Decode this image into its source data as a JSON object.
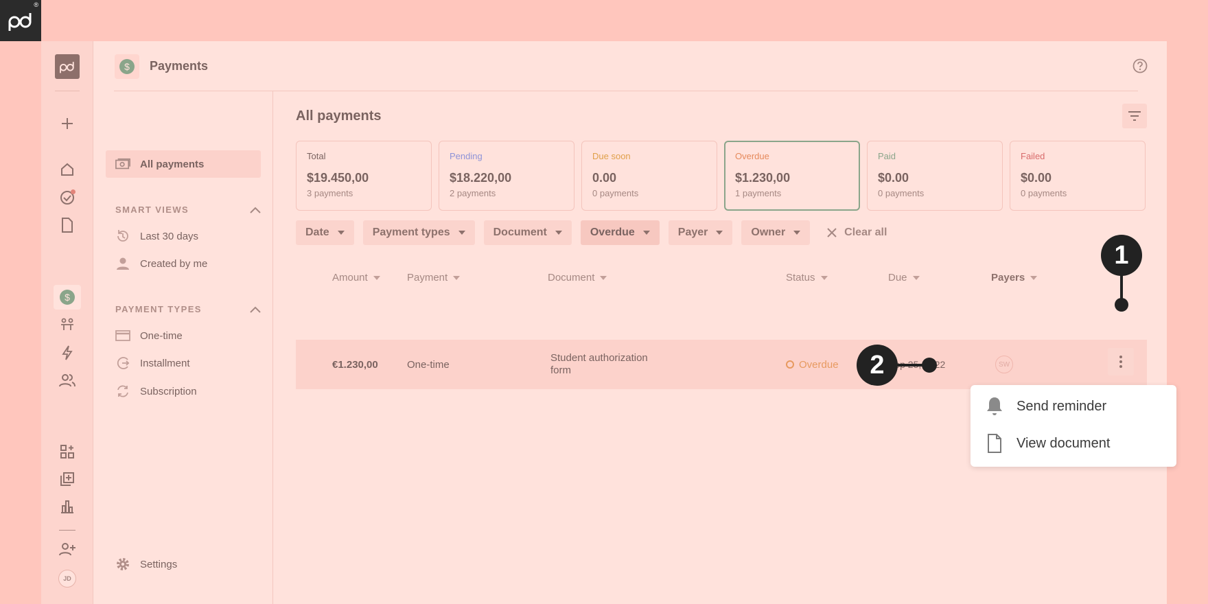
{
  "header": {
    "title": "Payments"
  },
  "subnav": {
    "all_payments": "All payments",
    "smart_views_title": "SMART VIEWS",
    "smart_views": [
      "Last 30 days",
      "Created by me"
    ],
    "payment_types_title": "PAYMENT TYPES",
    "payment_types": [
      "One-time",
      "Installment",
      "Subscription"
    ],
    "settings": "Settings"
  },
  "rail": {
    "avatar_initials": "JD"
  },
  "main": {
    "title": "All payments",
    "cards": [
      {
        "label": "Total",
        "value": "$19.450,00",
        "sub": "3 payments",
        "color": "#7a6360"
      },
      {
        "label": "Pending",
        "value": "$18.220,00",
        "sub": "2 payments",
        "color": "#8e93d8"
      },
      {
        "label": "Due soon",
        "value": "0.00",
        "sub": "0 payments",
        "color": "#e0a04a"
      },
      {
        "label": "Overdue",
        "value": "$1.230,00",
        "sub": "1 payments",
        "color": "#e68a5c"
      },
      {
        "label": "Paid",
        "value": "$0.00",
        "sub": "0 payments",
        "color": "#8aa58a"
      },
      {
        "label": "Failed",
        "value": "$0.00",
        "sub": "0 payments",
        "color": "#d86b6b"
      }
    ],
    "filters": [
      "Date",
      "Payment types",
      "Document",
      "Overdue",
      "Payer",
      "Owner"
    ],
    "clear_all": "Clear all",
    "columns": [
      "Amount",
      "Payment",
      "Document",
      "Status",
      "Due",
      "Payers"
    ],
    "row": {
      "amount": "€1.230,00",
      "payment": "One-time",
      "document_line1": "Student authorization",
      "document_line2": "form",
      "status": "Overdue",
      "due": "Sep 25, 2022",
      "payer_initials": "SW"
    }
  },
  "menu": {
    "send_reminder": "Send reminder",
    "view_document": "View document"
  },
  "callouts": {
    "one": "1",
    "two": "2"
  }
}
